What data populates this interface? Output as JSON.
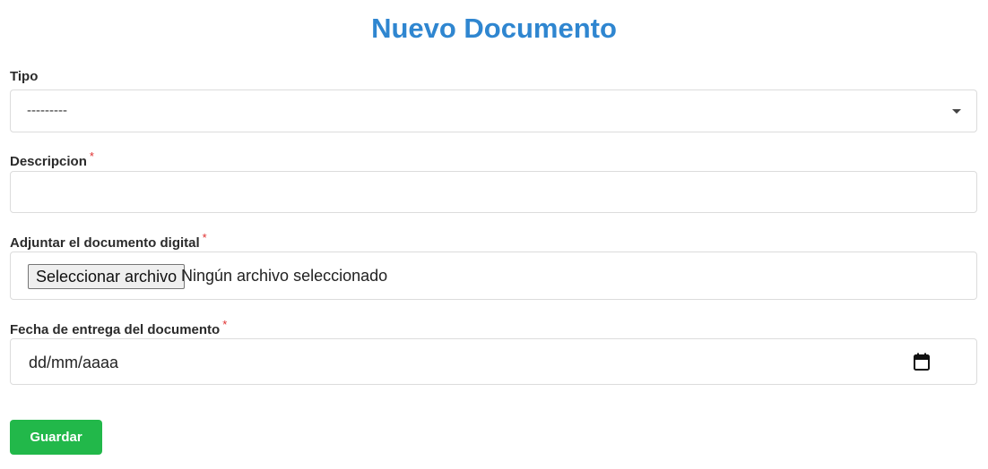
{
  "page": {
    "title": "Nuevo Documento"
  },
  "form": {
    "tipo": {
      "label": "Tipo",
      "selected": "---------"
    },
    "descripcion": {
      "label": "Descripcion",
      "required_mark": "*",
      "value": "",
      "placeholder": ""
    },
    "adjunto": {
      "label": "Adjuntar el documento digital",
      "required_mark": "*",
      "button_label": "Seleccionar archivo",
      "status_text": "Ningún archivo seleccionado"
    },
    "fecha": {
      "label": "Fecha de entrega del documento",
      "required_mark": "*",
      "placeholder": "dd/mm/aaaa",
      "icon": "calendar-icon"
    },
    "submit_label": "Guardar"
  },
  "colors": {
    "title": "#2f86d0",
    "required": "#e03030",
    "submit": "#22b84a"
  }
}
